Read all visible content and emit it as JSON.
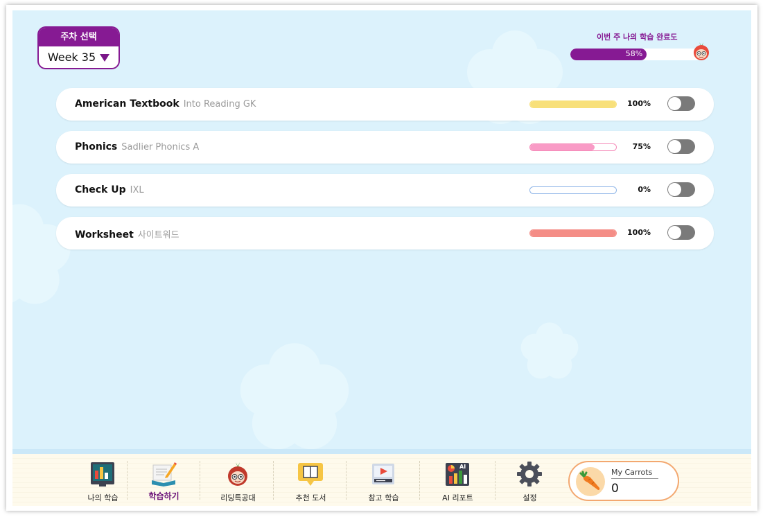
{
  "week_selector": {
    "title": "주차 선택",
    "value": "Week 35"
  },
  "weekly_progress": {
    "label": "이번 주 나의 학습 완료도",
    "percent_text": "58%",
    "fraction": 0.58,
    "color": "#861a93"
  },
  "rows": [
    {
      "title": "American Textbook",
      "subtitle": "Into Reading GK",
      "percent_text": "100%",
      "fraction": 1.0,
      "color": "#f8e07a",
      "border": "#f8e07a"
    },
    {
      "title": "Phonics",
      "subtitle": "Sadlier Phonics A",
      "percent_text": "75%",
      "fraction": 0.75,
      "color": "#f99bc6",
      "border": "#f58ab8"
    },
    {
      "title": "Check Up",
      "subtitle": "IXL",
      "percent_text": "0%",
      "fraction": 0.0,
      "color": "#8fb5e8",
      "border": "#8fb5e8"
    },
    {
      "title": "Worksheet",
      "subtitle": "사이트워드",
      "percent_text": "100%",
      "fraction": 1.0,
      "color": "#f48d86",
      "border": "#f48d86"
    }
  ],
  "nav": {
    "items": [
      {
        "label": "나의 학습",
        "icon": "chart-board-icon"
      },
      {
        "label": "학습하기",
        "icon": "open-book-pencil-icon"
      },
      {
        "label": "리딩특공대",
        "icon": "mascot-icon"
      },
      {
        "label": "추천 도서",
        "icon": "book-bubble-icon"
      },
      {
        "label": "참고 학습",
        "icon": "video-play-icon"
      },
      {
        "label": "AI 리포트",
        "icon": "ai-report-icon"
      },
      {
        "label": "설정",
        "icon": "gear-icon"
      }
    ],
    "active_index": 1
  },
  "carrots": {
    "label": "My Carrots",
    "value": "0",
    "icon": "carrot-icon"
  }
}
